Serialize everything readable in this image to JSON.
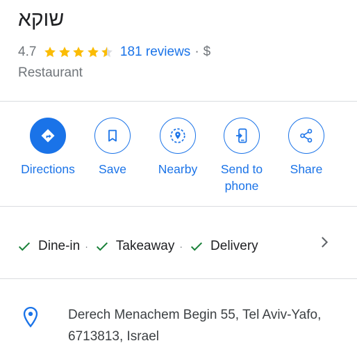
{
  "place": {
    "name": "שוקא",
    "rating": "4.7",
    "star_rating": 4.5,
    "reviews_label": "181 reviews",
    "separator": "·",
    "price": "$",
    "category": "Restaurant"
  },
  "actions": [
    {
      "label": "Directions",
      "icon": "directions-icon"
    },
    {
      "label": "Save",
      "icon": "bookmark-icon"
    },
    {
      "label": "Nearby",
      "icon": "nearby-icon"
    },
    {
      "label": "Send to phone",
      "icon": "send-to-phone-icon"
    },
    {
      "label": "Share",
      "icon": "share-icon"
    }
  ],
  "services": [
    {
      "label": "Dine-in",
      "icon": "check-icon"
    },
    {
      "label": "Takeaway",
      "icon": "check-icon"
    },
    {
      "label": "Delivery",
      "icon": "check-icon"
    }
  ],
  "service_separator": "·",
  "address": {
    "text": "Derech Menachem Begin 55, Tel Aviv-Yafo, 6713813, Israel",
    "icon": "location-pin-icon"
  },
  "colors": {
    "accent": "#1a73e8",
    "star": "#fbbc04",
    "check": "#188038",
    "secondary_text": "#70757a",
    "divider": "#dadce0"
  }
}
